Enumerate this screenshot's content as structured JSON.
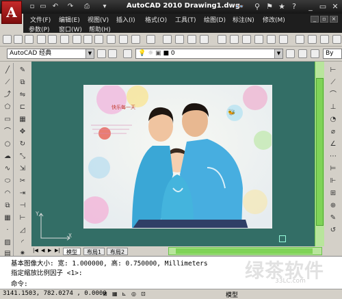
{
  "window": {
    "logo_letter": "A",
    "title": "AutoCAD 2010    Drawing1.dwg"
  },
  "menubar": {
    "items": [
      "文件(F)",
      "编辑(E)",
      "视图(V)",
      "插入(I)",
      "格式(O)",
      "工具(T)",
      "绘图(D)",
      "标注(N)",
      "修改(M)",
      "参数(P)",
      "窗口(W)",
      "帮助(H)"
    ]
  },
  "toolbar2": {
    "workspace": "AutoCAD 经典",
    "layer": "0",
    "style_right": "By"
  },
  "tabs": {
    "model": "模型",
    "layout1": "布局1",
    "layout2": "布局2"
  },
  "ucs": {
    "x": "X",
    "y": "Y"
  },
  "command": {
    "line1": "基本图像大小: 宽: 1.000000, 高: 0.750000, Millimeters",
    "line2": "指定缩放比例因子 <1>:",
    "line3": "命令:"
  },
  "status": {
    "coords": "3141.1503, 782.0274 , 0.0000",
    "mode": "模型"
  },
  "photo": {
    "caption": "快乐每一天"
  },
  "watermark": {
    "text": "绿茶软件园",
    "url": "33LC.com"
  },
  "colors": {
    "drawing_bg": "#336e66",
    "title_bg": "#1e1e1e",
    "scroll": "#7fd357"
  }
}
